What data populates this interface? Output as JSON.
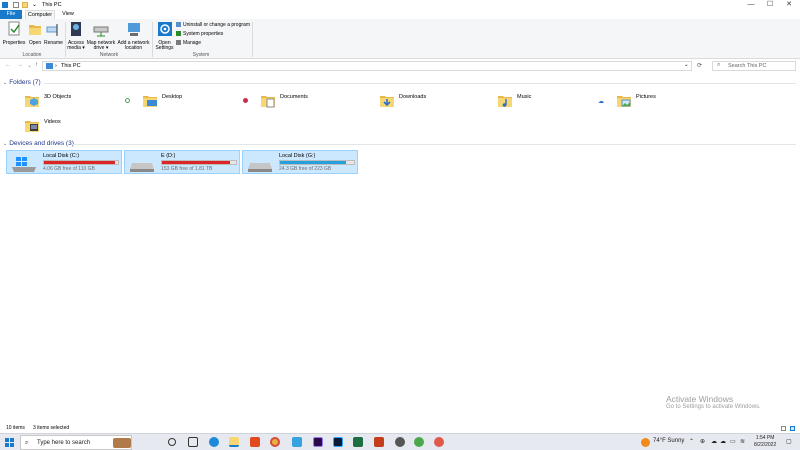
{
  "window": {
    "title": "This PC",
    "controls": {
      "minimize": "—",
      "maximize": "☐",
      "close": "✕"
    }
  },
  "tabs": [
    {
      "label": "File"
    },
    {
      "label": "Computer"
    },
    {
      "label": "View"
    }
  ],
  "ribbon": {
    "properties": "Properties",
    "open": "Open",
    "rename": "Rename",
    "access_media": "Access media ▾",
    "map_drive": "Map network drive ▾",
    "add_location": "Add a network location",
    "open_settings": "Open Settings",
    "uninstall": "Uninstall or change a program",
    "system_properties": "System properties",
    "manage": "Manage",
    "groups": {
      "location": "Location",
      "network": "Network",
      "system": "System"
    }
  },
  "address": {
    "back": "←",
    "forward": "→",
    "recent": "⌄",
    "up": "↑",
    "separator": "›",
    "path": "This PC",
    "dropdown": "⌄",
    "refresh": "⟳",
    "search_placeholder": "Search This PC"
  },
  "folders_section": {
    "chevron": "⌄",
    "title": "Folders (7)"
  },
  "folders": [
    {
      "name": "3D Objects"
    },
    {
      "name": "Desktop"
    },
    {
      "name": "Documents"
    },
    {
      "name": "Downloads"
    },
    {
      "name": "Music"
    },
    {
      "name": "Pictures"
    },
    {
      "name": "Videos"
    }
  ],
  "devices_section": {
    "chevron": "⌄",
    "title": "Devices and drives (3)"
  },
  "drives": [
    {
      "name": "Local Disk (C:)",
      "free": "4.06 GB free of 110 GB",
      "used_fraction": 0.963,
      "bar_color": "#da2626"
    },
    {
      "name": "E (D:)",
      "free": "153 GB free of 1.81 TB",
      "used_fraction": 0.917,
      "bar_color": "#da2626"
    },
    {
      "name": "Local Disk (G:)",
      "free": "24.3 GB free of 223 GB",
      "used_fraction": 0.891,
      "bar_color": "#26a0da"
    }
  ],
  "status": {
    "items": "10 items",
    "selected": "3 items selected"
  },
  "watermark": {
    "title": "Activate Windows",
    "subtitle": "Go to Settings to activate Windows."
  },
  "taskbar": {
    "search_placeholder": "Type here to search",
    "weather": "74°F  Sunny",
    "time": "1:54 PM",
    "date": "8/22/2022"
  },
  "colors": {
    "accent": "#1979ca",
    "selection": "#cce8ff",
    "drive_full": "#da2626",
    "drive_ok": "#26a0da",
    "section_header": "#1e3287"
  }
}
